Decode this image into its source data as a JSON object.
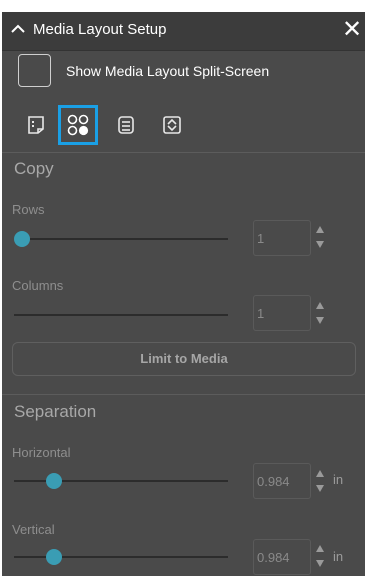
{
  "header": {
    "title": "Media Layout Setup"
  },
  "split_screen": {
    "label": "Show Media Layout Split-Screen",
    "checked": false
  },
  "modes": [
    "single-page-icon",
    "grid-copies-icon",
    "roll-icon",
    "fit-icon"
  ],
  "copy": {
    "section_title": "Copy",
    "rows": {
      "label": "Rows",
      "value": "1",
      "slider_fraction": 0.0
    },
    "columns": {
      "label": "Columns",
      "value": "1",
      "slider_fraction": 0.0
    },
    "limit_button": "Limit to Media"
  },
  "separation": {
    "section_title": "Separation",
    "horizontal": {
      "label": "Horizontal",
      "value": "0.984",
      "unit": "in"
    },
    "vertical": {
      "label": "Vertical",
      "value": "0.984",
      "unit": "in"
    }
  },
  "colors": {
    "panel_bg": "#4a4a4a",
    "accent": "#1aa0e6",
    "slider_thumb": "#3a9db4"
  }
}
